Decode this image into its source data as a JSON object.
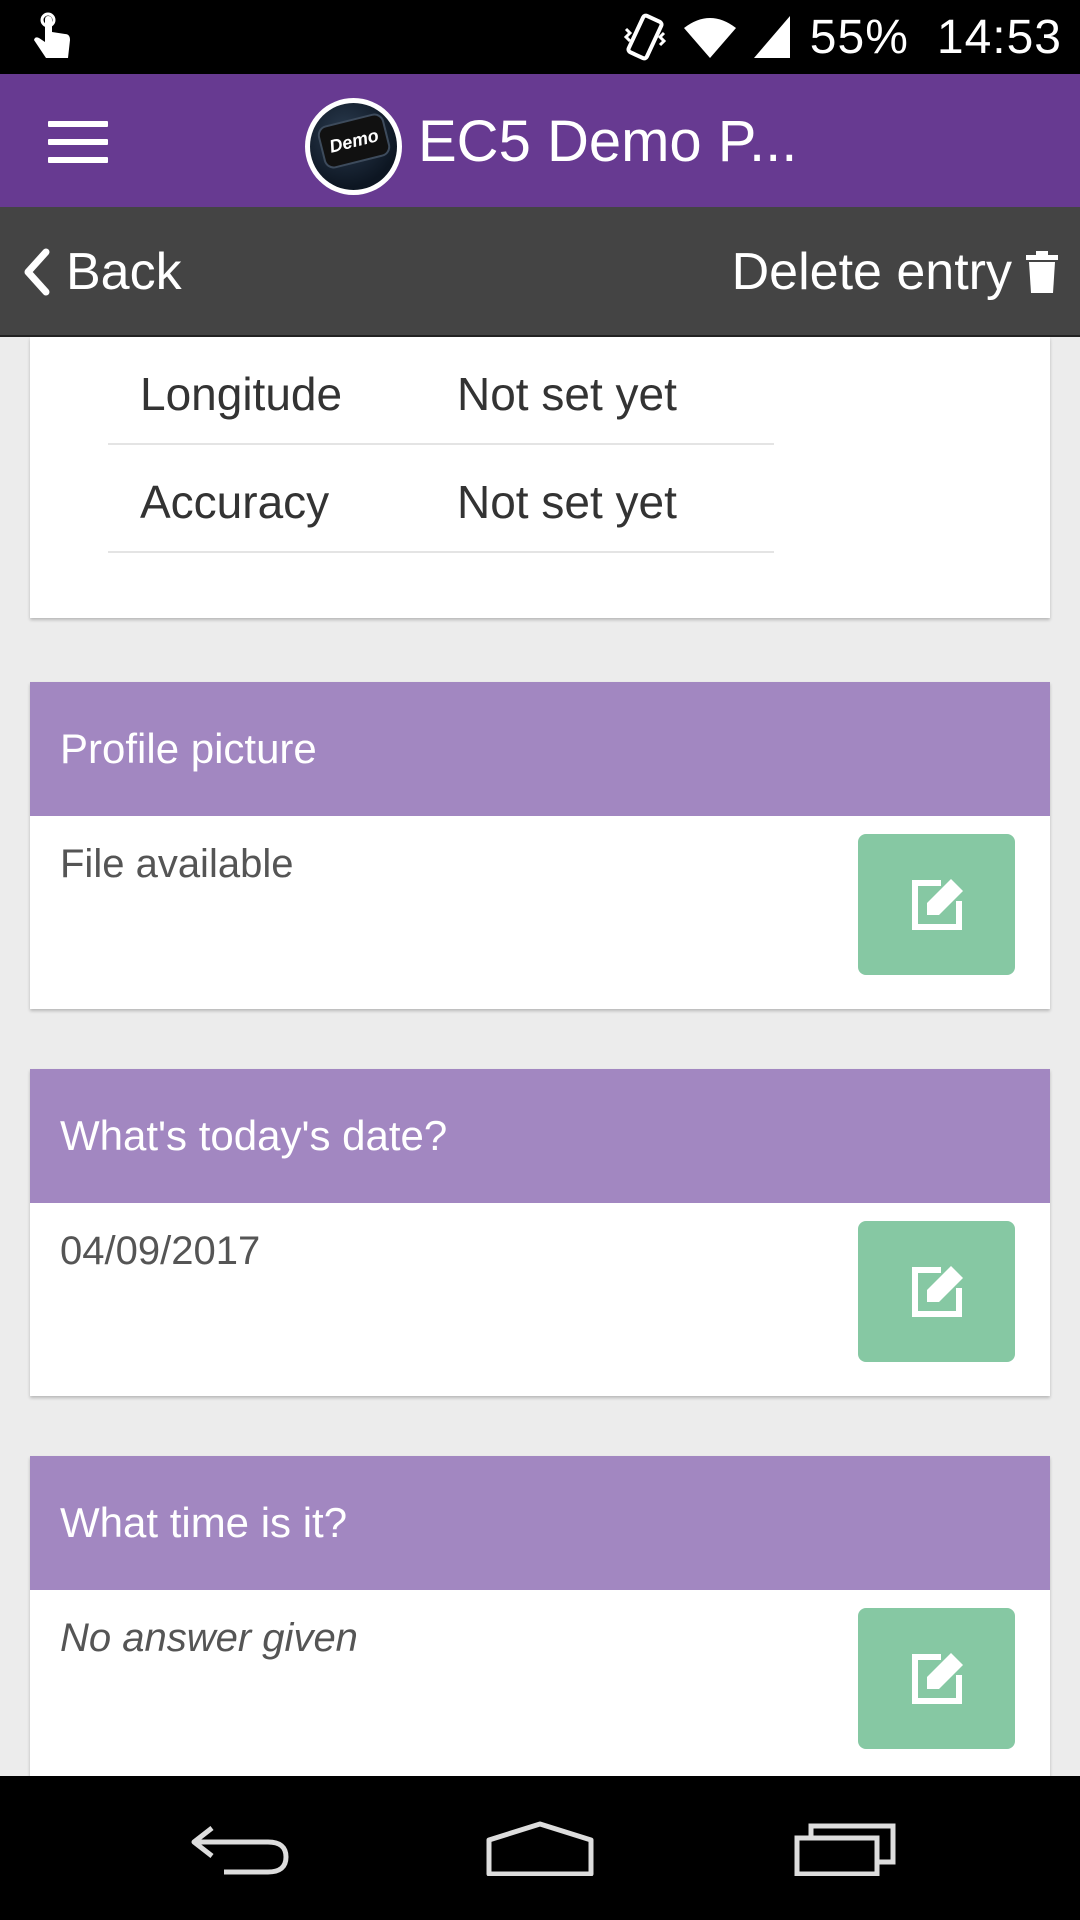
{
  "status_bar": {
    "battery": "55%",
    "time": "14:53",
    "icons": [
      "touch-icon",
      "vibrate-icon",
      "wifi-icon",
      "signal-icon"
    ]
  },
  "app_bar": {
    "logo_text": "Demo",
    "title": "EC5 Demo P..."
  },
  "sub_bar": {
    "back_label": "Back",
    "delete_label": "Delete entry"
  },
  "location": {
    "rows": [
      {
        "key": "Longitude",
        "value": "Not set yet"
      },
      {
        "key": "Accuracy",
        "value": "Not set yet"
      }
    ]
  },
  "questions": [
    {
      "title": "Profile picture",
      "answer": "File available"
    },
    {
      "title": "What's today's date?",
      "answer": "04/09/2017"
    },
    {
      "title": "What time is it?",
      "answer": "No answer given"
    }
  ],
  "colors": {
    "app_bar": "#673A91",
    "sub_bar": "#444444",
    "question_header": "#A287C1",
    "edit_button": "#86C8A3"
  }
}
